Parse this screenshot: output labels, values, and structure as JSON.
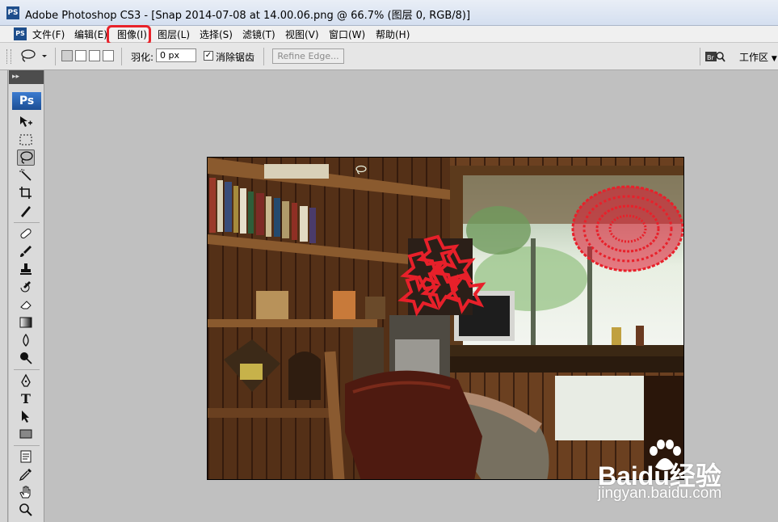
{
  "window": {
    "app_icon": "PS",
    "title": "Adobe Photoshop CS3 - [Snap 2014-07-08 at 14.00.06.png @ 66.7% (图层 0, RGB/8)]"
  },
  "menubar": {
    "ps_icon": "PS",
    "items": [
      "文件(F)",
      "编辑(E)",
      "图像(I)",
      "图层(L)",
      "选择(S)",
      "滤镜(T)",
      "视图(V)",
      "窗口(W)",
      "帮助(H)"
    ],
    "highlighted_item": "图像(I)",
    "highlight_color": "#e8222a"
  },
  "options": {
    "tool_preset_icon": "lasso-icon",
    "feather_label": "羽化:",
    "feather_value": "0 px",
    "antialias_label": "消除锯齿",
    "antialias_checked": true,
    "refine_edge_label": "Refine Edge...",
    "bridge_icon": "Br",
    "workspace_label": "工作区"
  },
  "toolbox": {
    "header_glyph": "▸▸",
    "badge": "Ps",
    "active_tool": "lasso",
    "tools": [
      "move",
      "marquee",
      "lasso",
      "quick-selection",
      "crop",
      "slice",
      "healing-brush",
      "brush",
      "clone-stamp",
      "history-brush",
      "eraser",
      "gradient",
      "blur",
      "dodge",
      "pen",
      "type",
      "path-selection",
      "shape",
      "notes",
      "eyedropper",
      "hand",
      "zoom"
    ],
    "type_glyph": "T"
  },
  "canvas": {
    "zoom": "66.7%",
    "layer": "图层 0",
    "mode": "RGB/8",
    "selection_shapes": [
      "star-cluster-selection",
      "circular-lace-selection"
    ],
    "selection_color": "#e8202a"
  },
  "watermark": {
    "text": "Baidu经验",
    "url": "jingyan.baidu.com"
  }
}
